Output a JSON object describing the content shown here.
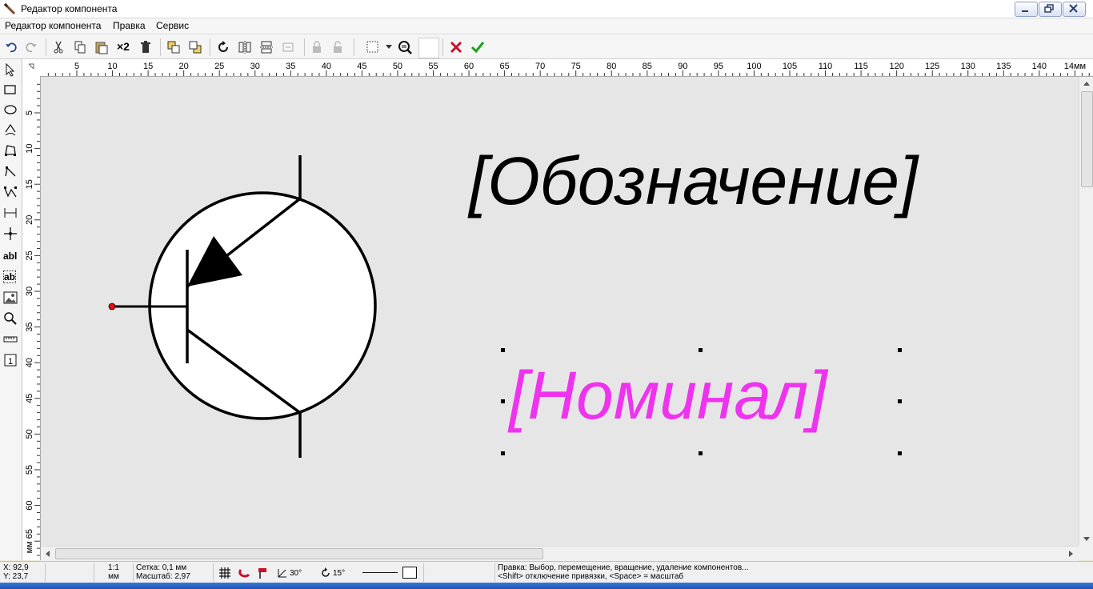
{
  "window": {
    "title": "Редактор компонента"
  },
  "menu": {
    "items": [
      "Редактор компонента",
      "Правка",
      "Сервис"
    ]
  },
  "toolbar": {
    "multiply_label": "×2"
  },
  "hruler": {
    "labels": [
      "5",
      "10",
      "15",
      "20",
      "25",
      "30",
      "35",
      "40",
      "45",
      "50",
      "55",
      "60",
      "65",
      "70",
      "75",
      "80",
      "85",
      "90",
      "95",
      "100",
      "105",
      "110",
      "115",
      "120",
      "125",
      "130",
      "135",
      "140",
      "14мм"
    ]
  },
  "vruler": {
    "labels": [
      "5",
      "10",
      "15",
      "20",
      "25",
      "30",
      "35",
      "40",
      "45",
      "50",
      "55",
      "60",
      "мм 65"
    ]
  },
  "canvas": {
    "designation": "[Обозначение]",
    "nominal": "[Номинал]",
    "nominal_color": "#ee33ee"
  },
  "status": {
    "x": "X: 92,9",
    "y": "Y: 23,7",
    "scale_ratio": "1:1",
    "scale_unit": "мм",
    "grid": "Сетка: 0,1 мм",
    "zoom": "Масштаб:  2,97",
    "angle1": "30°",
    "angle2": "15°",
    "hint1": "Правка: Выбор, перемещение, вращение, удаление компонентов...",
    "hint2": "<Shift> отключение привязки, <Space> =  масштаб"
  }
}
